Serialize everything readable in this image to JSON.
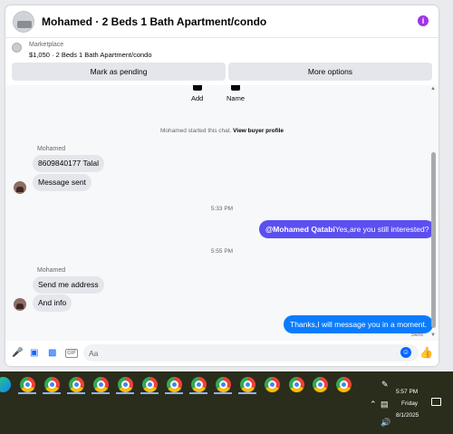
{
  "header": {
    "title": "Mohamed · 2 Beds 1 Bath Apartment/condo",
    "info_icon": "i"
  },
  "listing": {
    "label": "Marketplace",
    "summary": "$1,050 · 2 Beds 1 Bath Apartment/condo",
    "mark_pending_label": "Mark as pending",
    "more_options_label": "More options"
  },
  "quick_actions": {
    "add_label": "Add",
    "name_label": "Name"
  },
  "system_note": {
    "text": "Mohamed started this chat. ",
    "link": "View buyer profile"
  },
  "messages": {
    "sender_1": "Mohamed",
    "msg_1": "8609840177 Talal",
    "msg_2": "Message sent",
    "time_1": "5:33 PM",
    "mention": "@Mohamed Qatabi",
    "msg_3": "Yes,are you still interested?",
    "time_2": "5:55 PM",
    "sender_2": "Mohamed",
    "msg_4": "Send me address",
    "msg_5": "And info",
    "msg_6": "Thanks,I will message you in a moment.",
    "status": "Sent"
  },
  "composer": {
    "placeholder": "Aa",
    "gif_label": "GIF"
  },
  "taskbar": {
    "time": "5:57 PM",
    "day": "Friday",
    "date": "8/1/2025"
  },
  "colors": {
    "accent_blue": "#0a7cff",
    "mention_purple": "#5b4ff2",
    "info_purple": "#a033e8"
  }
}
